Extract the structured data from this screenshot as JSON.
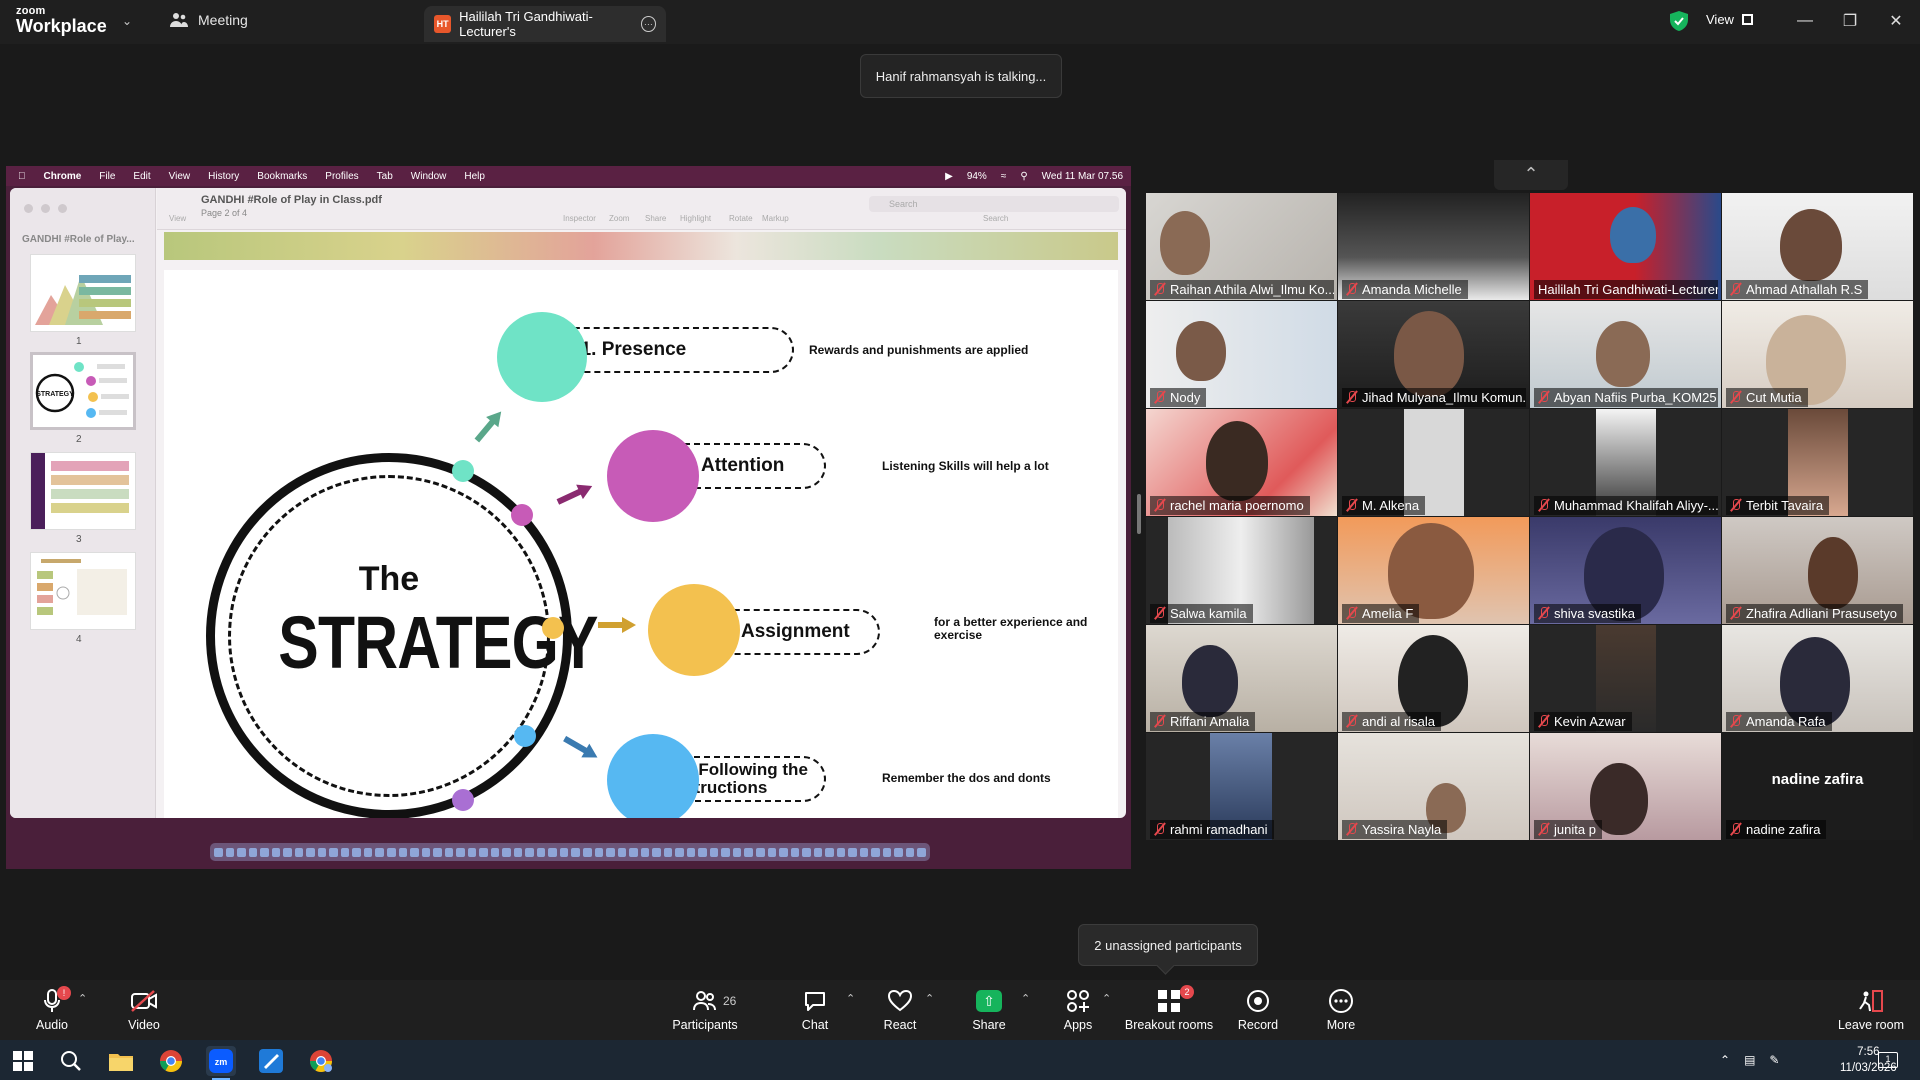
{
  "app": {
    "logo_line1": "zoom",
    "logo_line2": "Workplace",
    "meeting_tab": "Meeting",
    "share_tab_initials": "HT",
    "share_tab_title": "Haililah Tri Gandhiwati-Lecturer's",
    "view_label": "View"
  },
  "toast": {
    "text": "Hanif rahmansyah is talking..."
  },
  "mac": {
    "menu": [
      "Chrome",
      "File",
      "Edit",
      "View",
      "History",
      "Bookmarks",
      "Profiles",
      "Tab",
      "Window",
      "Help"
    ],
    "battery": "94%",
    "datetime": "Wed 11 Mar  07.56"
  },
  "preview": {
    "sidebar_title": "GANDHI #Role of Play...",
    "doc_title": "GANDHI #Role of Play in Class.pdf",
    "doc_page": "Page 2 of 4",
    "view_label": "View",
    "tools": [
      "Inspector",
      "Zoom",
      "Share",
      "Highlight",
      "Rotate",
      "Markup"
    ],
    "search_placeholder": "Search",
    "search_label": "Search",
    "thumb_numbers": [
      "1",
      "2",
      "3",
      "4"
    ]
  },
  "slide": {
    "title_small": "The",
    "title_big": "STRATEGY",
    "steps": [
      {
        "label": "01. Presence",
        "desc": "Rewards and punishments are applied",
        "color": "#6fe3c6"
      },
      {
        "label": "02. Attention",
        "desc": "Listening Skills will help a lot",
        "color": "#c75bb7"
      },
      {
        "label": "03. Assignment",
        "desc": "for a better experience and exercise",
        "color": "#f3c14f"
      },
      {
        "label": "04. Following the Instructions",
        "desc": "Remember the dos and donts",
        "color": "#56b8f2"
      }
    ]
  },
  "participants": [
    {
      "name": "Raihan Athila Alwi_Ilmu Ko..."
    },
    {
      "name": "Amanda Michelle"
    },
    {
      "name": "Haililah Tri Gandhiwati-Lecturer"
    },
    {
      "name": "Ahmad Athallah R.S"
    },
    {
      "name": "Nody"
    },
    {
      "name": "Jihad Mulyana_Ilmu Komun..."
    },
    {
      "name": "Abyan Nafiis Purba_KOM25"
    },
    {
      "name": "Cut Mutia"
    },
    {
      "name": "rachel maria poernomo"
    },
    {
      "name": "M. Alkena"
    },
    {
      "name": "Muhammad Khalifah Aliyy-..."
    },
    {
      "name": "Terbit Tavaira"
    },
    {
      "name": "Salwa kamila"
    },
    {
      "name": "Amelia F"
    },
    {
      "name": "shiva svastika"
    },
    {
      "name": "Zhafira Adliani Prasusetyo"
    },
    {
      "name": "Riffani Amalia"
    },
    {
      "name": "andi al risala"
    },
    {
      "name": "Kevin Azwar"
    },
    {
      "name": "Amanda Rafa"
    },
    {
      "name": "rahmi ramadhani"
    },
    {
      "name": "Yassira Nayla"
    },
    {
      "name": "junita p"
    },
    {
      "name": "nadine zafira",
      "center_name": "nadine zafira"
    }
  ],
  "unassigned": {
    "text": "2 unassigned participants"
  },
  "controls": {
    "audio": "Audio",
    "video": "Video",
    "participants": "Participants",
    "participants_count": "26",
    "chat": "Chat",
    "react": "React",
    "share": "Share",
    "apps": "Apps",
    "breakout": "Breakout rooms",
    "breakout_badge": "2",
    "record": "Record",
    "more": "More",
    "leave": "Leave room",
    "audio_badge": "!"
  },
  "taskbar": {
    "time": "7:56",
    "date": "11/03/2026",
    "notification_count": "1"
  }
}
